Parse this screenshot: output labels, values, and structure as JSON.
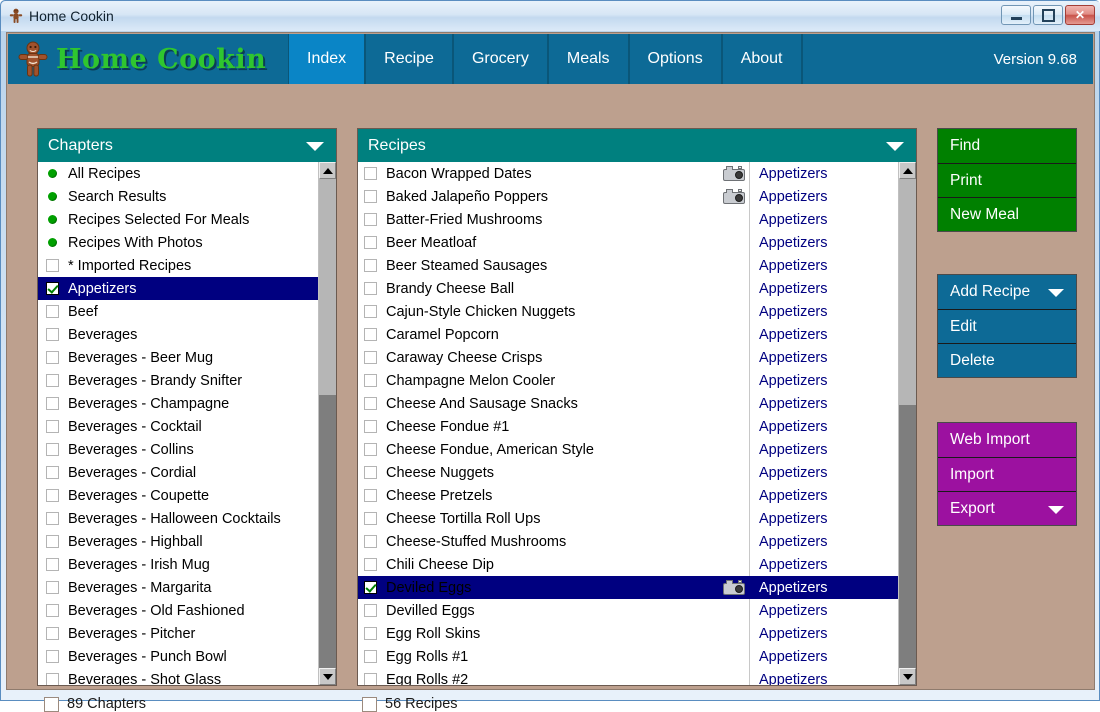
{
  "window": {
    "title": "Home Cookin",
    "icon": "gingerbread-man-icon",
    "minimize_label": "Minimize",
    "maximize_label": "Maximize",
    "close_label": "✕"
  },
  "navbar": {
    "brand": "Home Cookin",
    "version": "Version 9.68",
    "tabs": [
      {
        "label": "Index",
        "active": true
      },
      {
        "label": "Recipe",
        "active": false
      },
      {
        "label": "Grocery",
        "active": false
      },
      {
        "label": "Meals",
        "active": false
      },
      {
        "label": "Options",
        "active": false
      },
      {
        "label": "About",
        "active": false
      }
    ]
  },
  "chapters_panel": {
    "title": "Chapters",
    "items": [
      {
        "label": "All Recipes",
        "marker": "dot",
        "selected": false
      },
      {
        "label": "Search Results",
        "marker": "dot",
        "selected": false
      },
      {
        "label": "Recipes Selected For Meals",
        "marker": "dot",
        "selected": false
      },
      {
        "label": "Recipes With Photos",
        "marker": "dot",
        "selected": false
      },
      {
        "label": "* Imported Recipes",
        "marker": "checkbox",
        "selected": false,
        "checked": false
      },
      {
        "label": "Appetizers",
        "marker": "checkbox",
        "selected": true,
        "checked": true
      },
      {
        "label": "Beef",
        "marker": "checkbox",
        "selected": false,
        "checked": false
      },
      {
        "label": "Beverages",
        "marker": "checkbox",
        "selected": false,
        "checked": false
      },
      {
        "label": "Beverages - Beer Mug",
        "marker": "checkbox",
        "selected": false,
        "checked": false
      },
      {
        "label": "Beverages - Brandy Snifter",
        "marker": "checkbox",
        "selected": false,
        "checked": false
      },
      {
        "label": "Beverages - Champagne",
        "marker": "checkbox",
        "selected": false,
        "checked": false
      },
      {
        "label": "Beverages - Cocktail",
        "marker": "checkbox",
        "selected": false,
        "checked": false
      },
      {
        "label": "Beverages - Collins",
        "marker": "checkbox",
        "selected": false,
        "checked": false
      },
      {
        "label": "Beverages - Cordial",
        "marker": "checkbox",
        "selected": false,
        "checked": false
      },
      {
        "label": "Beverages - Coupette",
        "marker": "checkbox",
        "selected": false,
        "checked": false
      },
      {
        "label": "Beverages - Halloween Cocktails",
        "marker": "checkbox",
        "selected": false,
        "checked": false
      },
      {
        "label": "Beverages - Highball",
        "marker": "checkbox",
        "selected": false,
        "checked": false
      },
      {
        "label": "Beverages - Irish Mug",
        "marker": "checkbox",
        "selected": false,
        "checked": false
      },
      {
        "label": "Beverages - Margarita",
        "marker": "checkbox",
        "selected": false,
        "checked": false
      },
      {
        "label": "Beverages - Old Fashioned",
        "marker": "checkbox",
        "selected": false,
        "checked": false
      },
      {
        "label": "Beverages - Pitcher",
        "marker": "checkbox",
        "selected": false,
        "checked": false
      },
      {
        "label": "Beverages - Punch Bowl",
        "marker": "checkbox",
        "selected": false,
        "checked": false
      },
      {
        "label": "Beverages - Shot Glass",
        "marker": "checkbox",
        "selected": false,
        "checked": false
      }
    ],
    "scrollbar": {
      "thumb_top_pct": 0,
      "thumb_height_pct": 44
    }
  },
  "recipes_panel": {
    "title": "Recipes",
    "items": [
      {
        "label": "Bacon Wrapped Dates",
        "category": "Appetizers",
        "photo": true,
        "checked": false,
        "selected": false
      },
      {
        "label": "Baked Jalapeño Poppers",
        "category": "Appetizers",
        "photo": true,
        "checked": false,
        "selected": false
      },
      {
        "label": "Batter-Fried Mushrooms",
        "category": "Appetizers",
        "photo": false,
        "checked": false,
        "selected": false
      },
      {
        "label": "Beer Meatloaf",
        "category": "Appetizers",
        "photo": false,
        "checked": false,
        "selected": false
      },
      {
        "label": "Beer Steamed Sausages",
        "category": "Appetizers",
        "photo": false,
        "checked": false,
        "selected": false
      },
      {
        "label": "Brandy Cheese Ball",
        "category": "Appetizers",
        "photo": false,
        "checked": false,
        "selected": false
      },
      {
        "label": "Cajun-Style Chicken Nuggets",
        "category": "Appetizers",
        "photo": false,
        "checked": false,
        "selected": false
      },
      {
        "label": "Caramel Popcorn",
        "category": "Appetizers",
        "photo": false,
        "checked": false,
        "selected": false
      },
      {
        "label": "Caraway Cheese Crisps",
        "category": "Appetizers",
        "photo": false,
        "checked": false,
        "selected": false
      },
      {
        "label": "Champagne Melon Cooler",
        "category": "Appetizers",
        "photo": false,
        "checked": false,
        "selected": false
      },
      {
        "label": "Cheese And Sausage Snacks",
        "category": "Appetizers",
        "photo": false,
        "checked": false,
        "selected": false
      },
      {
        "label": "Cheese Fondue #1",
        "category": "Appetizers",
        "photo": false,
        "checked": false,
        "selected": false
      },
      {
        "label": "Cheese Fondue, American Style",
        "category": "Appetizers",
        "photo": false,
        "checked": false,
        "selected": false
      },
      {
        "label": "Cheese Nuggets",
        "category": "Appetizers",
        "photo": false,
        "checked": false,
        "selected": false
      },
      {
        "label": "Cheese Pretzels",
        "category": "Appetizers",
        "photo": false,
        "checked": false,
        "selected": false
      },
      {
        "label": "Cheese Tortilla Roll Ups",
        "category": "Appetizers",
        "photo": false,
        "checked": false,
        "selected": false
      },
      {
        "label": "Cheese-Stuffed Mushrooms",
        "category": "Appetizers",
        "photo": false,
        "checked": false,
        "selected": false
      },
      {
        "label": "Chili Cheese Dip",
        "category": "Appetizers",
        "photo": false,
        "checked": false,
        "selected": false
      },
      {
        "label": "Deviled Eggs",
        "category": "Appetizers",
        "photo": true,
        "checked": true,
        "selected": true
      },
      {
        "label": "Devilled Eggs",
        "category": "Appetizers",
        "photo": false,
        "checked": false,
        "selected": false
      },
      {
        "label": "Egg Roll Skins",
        "category": "Appetizers",
        "photo": false,
        "checked": false,
        "selected": false
      },
      {
        "label": "Egg Rolls #1",
        "category": "Appetizers",
        "photo": false,
        "checked": false,
        "selected": false
      },
      {
        "label": "Egg Rolls #2",
        "category": "Appetizers",
        "photo": false,
        "checked": false,
        "selected": false
      }
    ],
    "scrollbar": {
      "thumb_top_pct": 0,
      "thumb_height_pct": 46
    }
  },
  "action_buttons": {
    "green": [
      {
        "label": "Find"
      },
      {
        "label": "Print"
      },
      {
        "label": "New Meal"
      }
    ],
    "blue": [
      {
        "label": "Add Recipe",
        "caret": true
      },
      {
        "label": "Edit"
      },
      {
        "label": "Delete"
      }
    ],
    "purple": [
      {
        "label": "Web Import"
      },
      {
        "label": "Import"
      },
      {
        "label": "Export",
        "caret": true
      }
    ]
  },
  "statusbar": {
    "chapters_count": "89 Chapters",
    "recipes_count": "56 Recipes"
  },
  "colors": {
    "nav_blue": "#0d6a96",
    "nav_active": "#0a85c6",
    "panel_header_teal": "#00807f",
    "selection_navy": "#000080",
    "brand_green": "#2fc62f",
    "app_background": "#bda08e",
    "button_green": "#008000",
    "button_blue": "#0d6a96",
    "button_purple": "#9c11a0",
    "category_text": "#000080"
  }
}
